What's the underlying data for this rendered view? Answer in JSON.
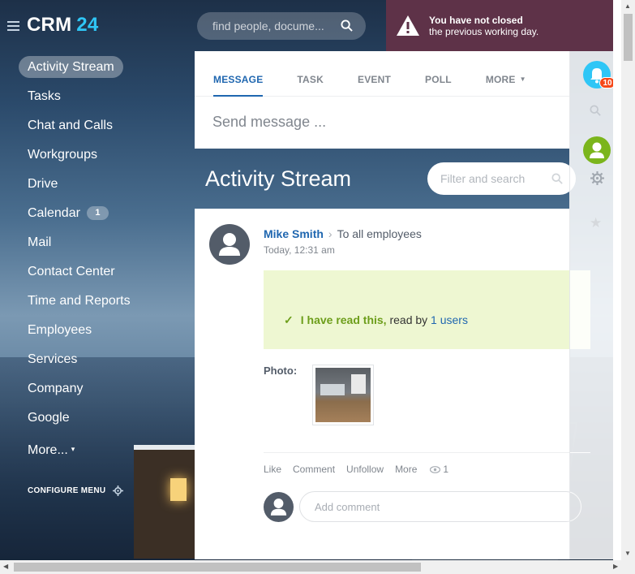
{
  "app": {
    "logo_name": "CRM",
    "logo_num": "24"
  },
  "header": {
    "search_placeholder": "find people, docume...",
    "alert_line1": "You have not closed",
    "alert_line2": "the previous working day."
  },
  "menu": {
    "items": [
      {
        "label": "Activity Stream",
        "active": true
      },
      {
        "label": "Tasks"
      },
      {
        "label": "Chat and Calls"
      },
      {
        "label": "Workgroups"
      },
      {
        "label": "Drive"
      },
      {
        "label": "Calendar",
        "badge": "1"
      },
      {
        "label": "Mail"
      },
      {
        "label": "Contact Center"
      },
      {
        "label": "Time and Reports"
      },
      {
        "label": "Employees"
      },
      {
        "label": "Services"
      },
      {
        "label": "Company"
      },
      {
        "label": "Google"
      },
      {
        "label": "More..."
      }
    ],
    "configure": "CONFIGURE MENU"
  },
  "composer": {
    "tabs": [
      "MESSAGE",
      "TASK",
      "EVENT",
      "POLL",
      "MORE"
    ],
    "send_placeholder": "Send message ..."
  },
  "stream": {
    "title": "Activity Stream",
    "filter_placeholder": "Filter and search"
  },
  "post": {
    "author": "Mike Smith",
    "recipient": "To all employees",
    "time": "Today, 12:31 am",
    "read_text": "I have read this,",
    "read_by": "read by",
    "read_count": "1 users",
    "photo_label": "Photo:",
    "actions": {
      "like": "Like",
      "comment": "Comment",
      "unfollow": "Unfollow",
      "more": "More",
      "views": "1"
    },
    "comment_placeholder": "Add comment"
  },
  "rail": {
    "notifications": "10"
  },
  "colors": {
    "accent": "#2067b0",
    "brand_blue": "#2fc6f6",
    "alert_bg": "#5e3248",
    "read_bg": "#eef7d2",
    "green": "#6d9e1b"
  }
}
